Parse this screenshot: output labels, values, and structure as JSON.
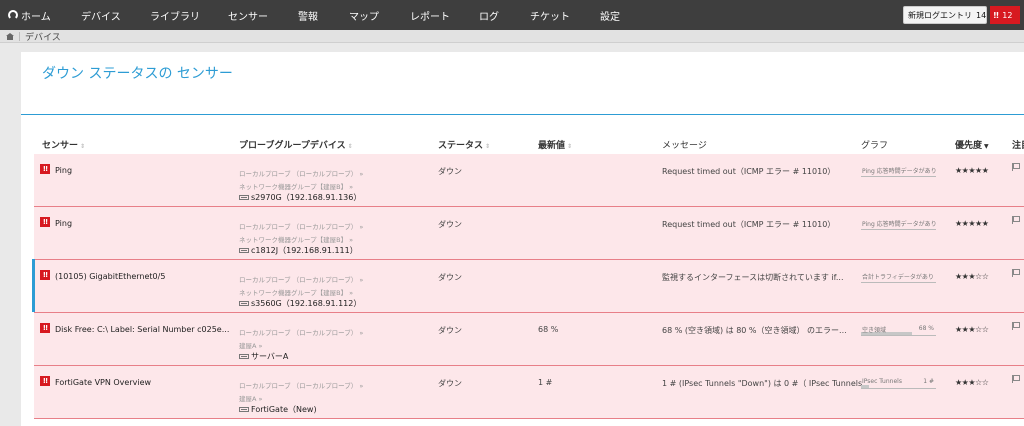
{
  "nav": {
    "items": [
      "ホーム",
      "デバイス",
      "ライブラリ",
      "センサー",
      "警報",
      "マップ",
      "レポート",
      "ログ",
      "チケット",
      "設定"
    ],
    "newlog_label": "新規ログエントリ",
    "newlog_count": "14",
    "alarm_count": "12"
  },
  "breadcrumb": {
    "current": "デバイス"
  },
  "page": {
    "title": "ダウン ステータスの センサー"
  },
  "columns": {
    "sensor": "センサー",
    "probe": "プローブグループデバイス",
    "status": "ステータス",
    "lastval": "最新値",
    "message": "メッセージ",
    "graph": "グラフ",
    "priority": "優先度",
    "notes": "注目"
  },
  "rows": [
    {
      "sensor": "Ping",
      "path1": "ローカルプローブ （ローカルプローブ） »",
      "path2": "ネットワーク機器グループ【建屋B】 »",
      "device": "s2970G（192.168.91.136）",
      "status": "ダウン",
      "lastval": "",
      "message": "Request timed out（ICMP エラー # 11010）",
      "graph_text": "Ping 応答時間データがあり",
      "graph_value": "",
      "graph_level": 0,
      "stars": "★★★★★"
    },
    {
      "sensor": "Ping",
      "path1": "ローカルプローブ （ローカルプローブ） »",
      "path2": "ネットワーク機器グループ【建屋B】 »",
      "device": "c1812J（192.168.91.111）",
      "status": "ダウン",
      "lastval": "",
      "message": "Request timed out（ICMP エラー # 11010）",
      "graph_text": "Ping 応答時間データがあり",
      "graph_value": "",
      "graph_level": 0,
      "stars": "★★★★★"
    },
    {
      "sensor": "(10105) GigabitEthernet0/5",
      "path1": "ローカルプローブ （ローカルプローブ） »",
      "path2": "ネットワーク機器グループ【建屋B】 »",
      "device": "s3560G（192.168.91.112）",
      "status": "ダウン",
      "lastval": "",
      "message": "監視するインターフェースは切断されています if...",
      "graph_text": "合計トラフィデータがあり",
      "graph_value": "",
      "graph_level": 0,
      "stars": "★★★☆☆"
    },
    {
      "sensor": "Disk Free: C:\\ Label: Serial Number c025e...",
      "path1": "ローカルプローブ （ローカルプローブ） »",
      "path2": "建屋A »",
      "device": "サーバーA",
      "status": "ダウン",
      "lastval": "68 %",
      "message": "68 % (空き領域) は 80 %（空き領域） のエラー...",
      "graph_text": "空き領域",
      "graph_value": "68 %",
      "graph_level": 0.68,
      "stars": "★★★☆☆"
    },
    {
      "sensor": "FortiGate VPN Overview",
      "path1": "ローカルプローブ （ローカルプローブ） »",
      "path2": "建屋A »",
      "device": "FortiGate（New)",
      "status": "ダウン",
      "lastval": "1 #",
      "message": "1 # (IPsec Tunnels \"Down\") は 0 #（ IPsec Tunnels...",
      "graph_text": "IPsec Tunnels",
      "graph_value": "1 #",
      "graph_level": 0.1,
      "stars": "★★★☆☆"
    }
  ]
}
